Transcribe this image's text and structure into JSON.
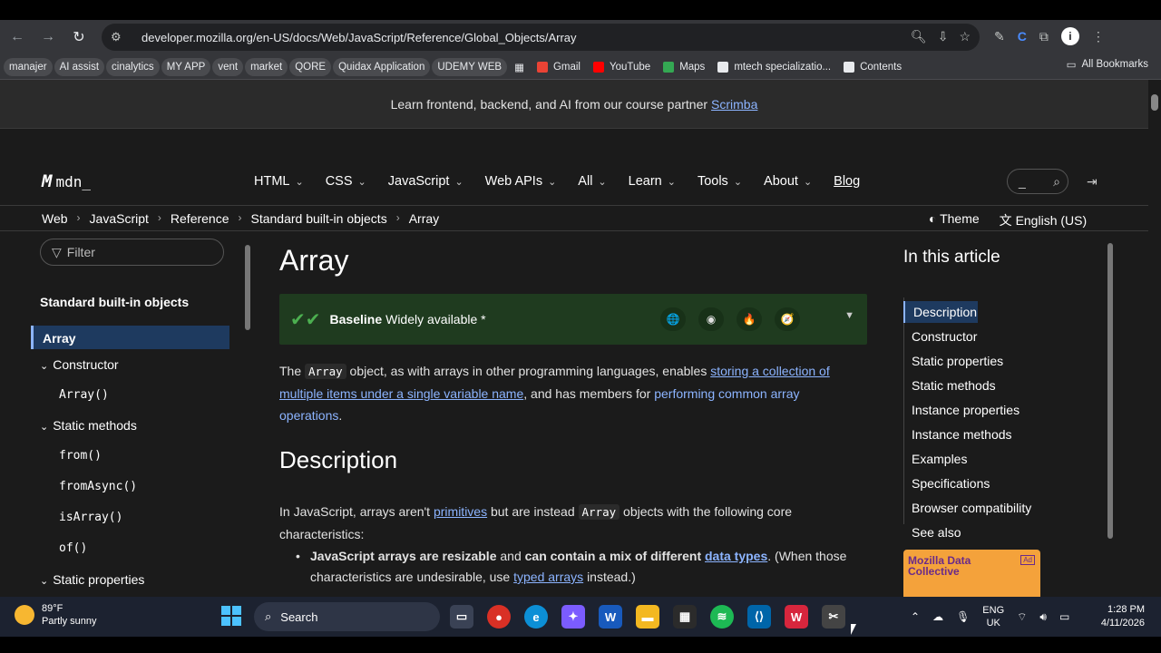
{
  "browser": {
    "url": "developer.mozilla.org/en-US/docs/Web/JavaScript/Reference/Global_Objects/Array",
    "bookmarks": [
      {
        "label": "manajer",
        "pill": true
      },
      {
        "label": "AI assist",
        "pill": true
      },
      {
        "label": "cinalytics",
        "pill": true
      },
      {
        "label": "MY APP",
        "pill": true
      },
      {
        "label": "vent",
        "pill": true
      },
      {
        "label": "market",
        "pill": true
      },
      {
        "label": "QORE",
        "pill": true
      },
      {
        "label": "Quidax Application",
        "pill": true
      },
      {
        "label": "UDEMY WEB",
        "pill": true
      },
      {
        "label": "Gmail",
        "pill": false
      },
      {
        "label": "YouTube",
        "pill": false
      },
      {
        "label": "Maps",
        "pill": false
      },
      {
        "label": "mtech specializatio...",
        "pill": false
      },
      {
        "label": "Contents",
        "pill": false
      }
    ],
    "all_bookmarks": "All Bookmarks"
  },
  "banner": {
    "text": "Learn frontend, backend, and AI from our course partner",
    "link": "Scrimba"
  },
  "mdn": {
    "logo": "mdn_",
    "menu": [
      "HTML",
      "CSS",
      "JavaScript",
      "Web APIs",
      "All",
      "Learn",
      "Tools",
      "About"
    ],
    "blog": "Blog",
    "search_placeholder": "_"
  },
  "breadcrumbs": [
    "Web",
    "JavaScript",
    "Reference",
    "Standard built-in objects",
    "Array"
  ],
  "theme_label": "Theme",
  "language_label": "English (US)",
  "sidebar": {
    "filter_placeholder": "Filter",
    "title": "Standard built-in objects",
    "active": "Array",
    "items": [
      {
        "label": "Constructor",
        "group": true
      },
      {
        "label": "Array()",
        "group": false
      },
      {
        "label": "Static methods",
        "group": true
      },
      {
        "label": "from()",
        "group": false
      },
      {
        "label": "fromAsync()",
        "group": false
      },
      {
        "label": "isArray()",
        "group": false
      },
      {
        "label": "of()",
        "group": false
      },
      {
        "label": "Static properties",
        "group": true
      }
    ]
  },
  "article": {
    "title": "Array",
    "baseline_bold": "Baseline",
    "baseline_text": "Widely available *",
    "intro": {
      "pre": "The",
      "code": "Array",
      "mid": "object, as with arrays in other programming languages, enables",
      "link1": "storing a collection of multiple items under a single variable name",
      "mid2": ", and has members for",
      "link2": "performing common array operations",
      "end": "."
    },
    "h2": "Description",
    "desc": {
      "pre": "In JavaScript, arrays aren't",
      "link": "primitives",
      "mid": "but are instead",
      "code": "Array",
      "end": "objects with the following core characteristics:"
    },
    "bullet": {
      "b1": "JavaScript arrays are resizable",
      "t1": "and",
      "b2": "can contain a mix of different",
      "link": "data types",
      "t2": ". (When those characteristics are undesirable, use",
      "link2": "typed arrays",
      "t3": "instead.)"
    }
  },
  "toc": {
    "title": "In this article",
    "items": [
      "Description",
      "Constructor",
      "Static properties",
      "Static methods",
      "Instance properties",
      "Instance methods",
      "Examples",
      "Specifications",
      "Browser compatibility",
      "See also"
    ]
  },
  "ad": {
    "text": "Mozilla Data Collective",
    "badge": "Ad"
  },
  "taskbar": {
    "temp": "89°F",
    "weather": "Partly sunny",
    "search": "Search",
    "lang1": "ENG",
    "lang2": "UK",
    "time": "1:28 PM",
    "date": "4/11/2026"
  }
}
